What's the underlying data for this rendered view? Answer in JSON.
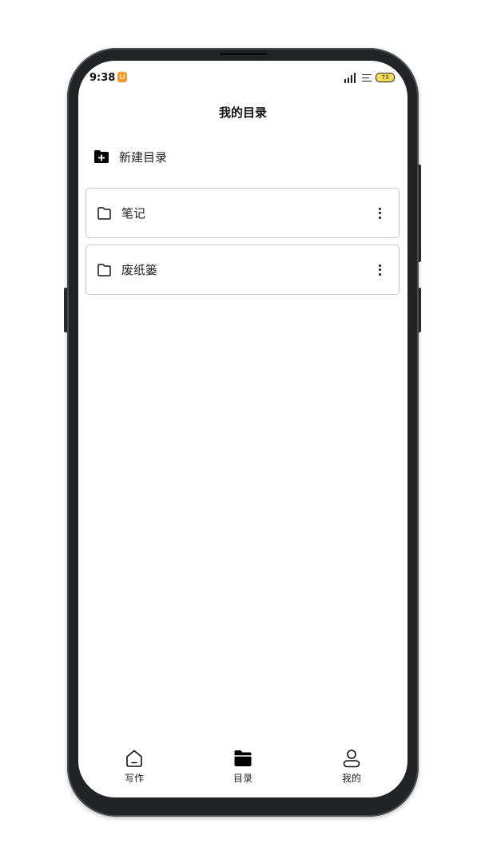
{
  "status_bar": {
    "time": "9:38",
    "battery": "73",
    "icons": [
      "app-notification-icon",
      "signal-icon",
      "wifi-icon",
      "battery-icon"
    ]
  },
  "header": {
    "title": "我的目录"
  },
  "actions": {
    "new_directory_label": "新建目录",
    "new_directory_icon": "folder-plus-icon"
  },
  "folders": [
    {
      "label": "笔记",
      "icon": "folder-icon",
      "menu_icon": "more-vertical-icon"
    },
    {
      "label": "废纸篓",
      "icon": "folder-icon",
      "menu_icon": "more-vertical-icon"
    }
  ],
  "tabs": [
    {
      "label": "写作",
      "icon": "home-icon",
      "active": false
    },
    {
      "label": "目录",
      "icon": "folder-filled-icon",
      "active": true
    },
    {
      "label": "我的",
      "icon": "user-icon",
      "active": false
    }
  ],
  "colors": {
    "accent": "#000000",
    "text": "#222222",
    "border": "#c7c7c7",
    "status_app": "#f29a32",
    "battery": "#f4dc5b"
  }
}
